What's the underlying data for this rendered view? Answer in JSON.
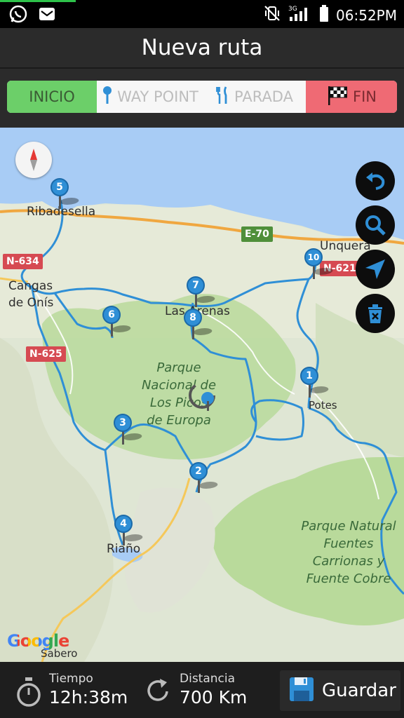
{
  "status_bar": {
    "time": "06:52PM",
    "network": "3G",
    "icons": [
      "whatsapp-icon",
      "email-icon",
      "vibrate-off-icon",
      "signal-icon",
      "battery-icon"
    ]
  },
  "header": {
    "title": "Nueva ruta"
  },
  "segments": {
    "inicio": "INICIO",
    "waypoint": "WAY POINT",
    "parada": "PARADA",
    "fin": "FIN"
  },
  "map": {
    "places": {
      "ribadesella": "Ribadesella",
      "unquera": "Unquera",
      "cangas_1": "Cangas",
      "cangas_2": "de Onís",
      "las_arenas": "Las Arenas",
      "potes": "Potes",
      "riano": "Riaño",
      "sabero": "Sabero"
    },
    "parks": {
      "picos": [
        "Parque",
        "Nacional de",
        "Los Picos",
        "de Europa"
      ],
      "fuentes": [
        "Parque Natural",
        "Fuentes",
        "Carrionas y",
        "Fuente Cobre"
      ]
    },
    "roads": {
      "n634": "N-634",
      "e70": "E-70",
      "n621": "N-621",
      "n625": "N-625"
    },
    "waypoints": [
      "1",
      "2",
      "3",
      "4",
      "5",
      "6",
      "7",
      "8",
      "10"
    ],
    "attribution": "Google"
  },
  "footer": {
    "time_label": "Tiempo",
    "time_value": "12h:38m",
    "distance_label": "Distancia",
    "distance_value": "700 Km",
    "save_label": "Guardar"
  },
  "colors": {
    "inicio": "#6ccf69",
    "fin": "#ef6a74",
    "route": "#2f8fd6",
    "header": "#2b2b2b"
  }
}
